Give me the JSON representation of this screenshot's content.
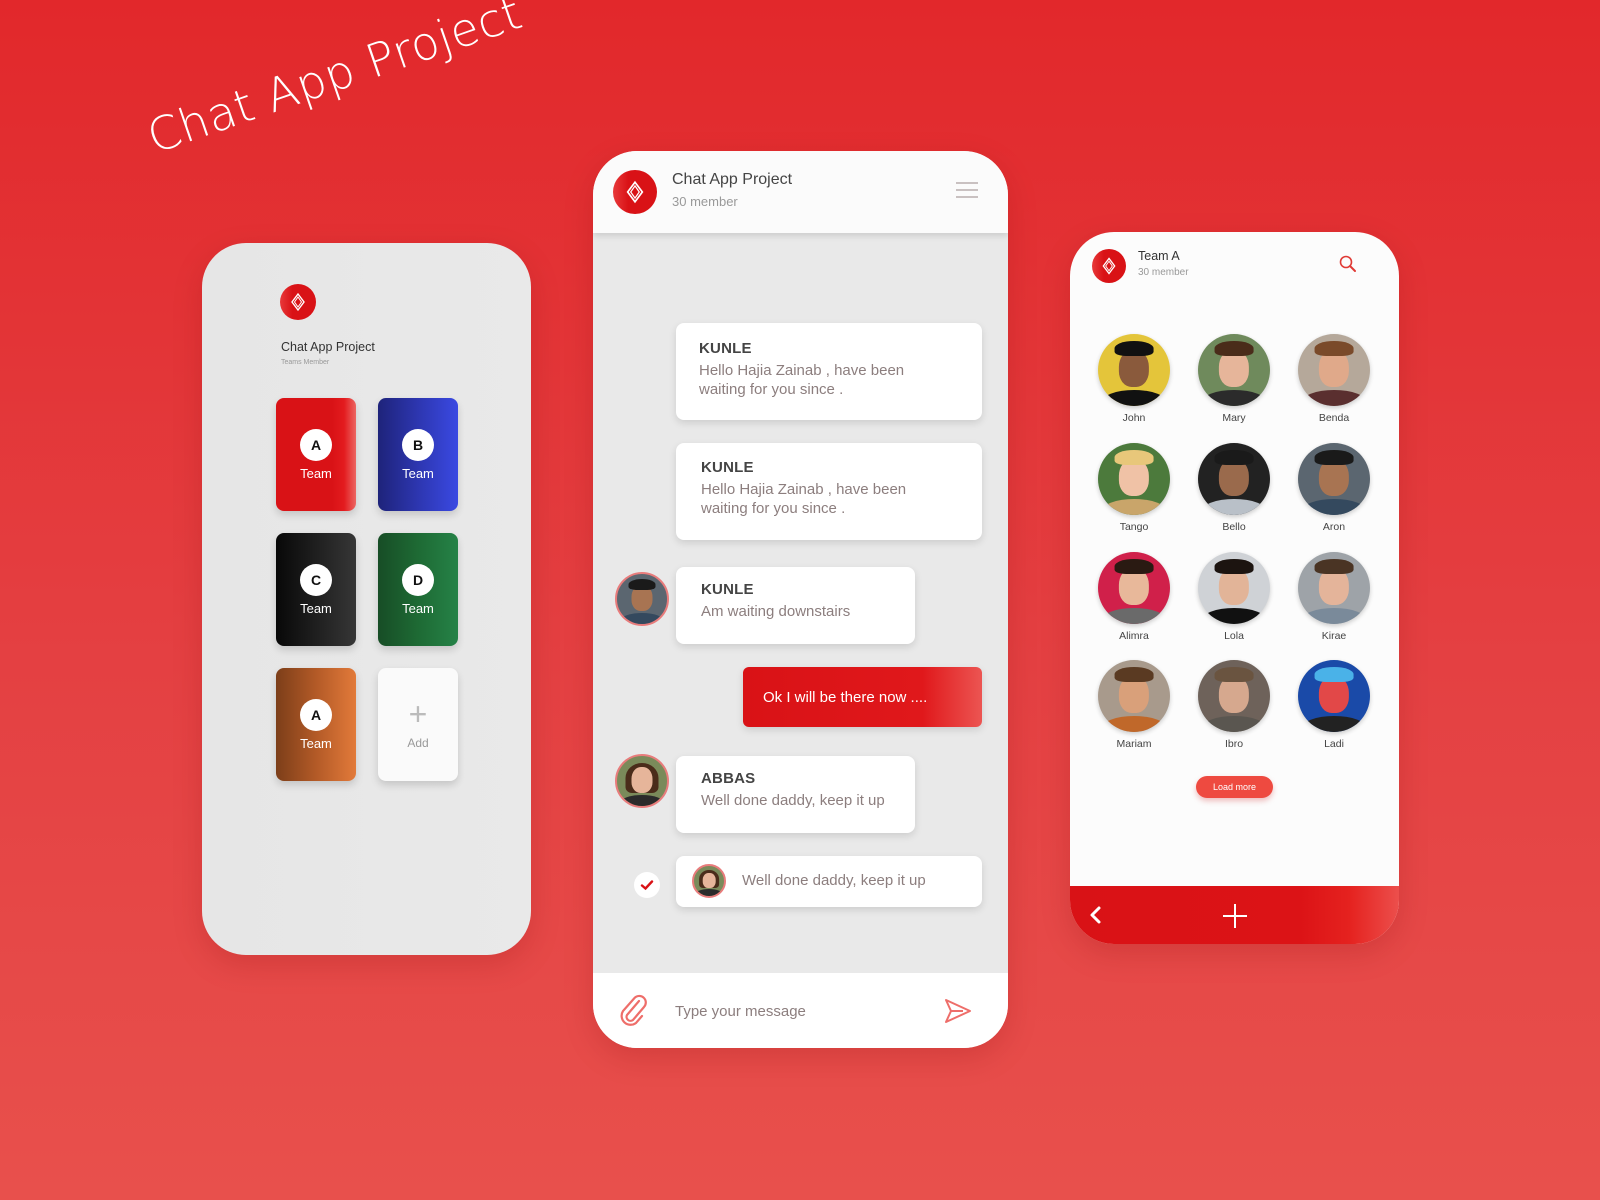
{
  "hero": {
    "title": "Chat App Project"
  },
  "teams_screen": {
    "title": "Chat App Project",
    "subtitle": "Teams Member",
    "teams": [
      {
        "letter": "A",
        "label": "Team",
        "gradient": [
          "#d91216",
          "#e31b1e",
          "#ec6662"
        ]
      },
      {
        "letter": "B",
        "label": "Team",
        "gradient": [
          "#1e237a",
          "#2d36b0",
          "#3a49e2"
        ]
      },
      {
        "letter": "C",
        "label": "Team",
        "gradient": [
          "#080808",
          "#1f1f1f",
          "#363636"
        ]
      },
      {
        "letter": "D",
        "label": "Team",
        "gradient": [
          "#174d26",
          "#1e6a34",
          "#258247"
        ]
      },
      {
        "letter": "A",
        "label": "Team",
        "gradient": [
          "#7c3e19",
          "#b35a27",
          "#e27a3a"
        ]
      }
    ],
    "add_label": "Add",
    "add_icon": "plus-icon"
  },
  "chat_screen": {
    "header": {
      "title": "Chat App Project",
      "subtitle": "30 member",
      "menu_icon": "hamburger-icon"
    },
    "messages": [
      {
        "name": "KUNLE",
        "text": "Hello Hajia Zainab , have been waiting for you since ."
      },
      {
        "name": "KUNLE",
        "text": "Hello Hajia Zainab , have been waiting for you since ."
      },
      {
        "name": "KUNLE",
        "text": "Am waiting downstairs"
      },
      {
        "name": "",
        "text": "Ok I will be there now ...."
      },
      {
        "name": "ABBAS",
        "text": "Well done daddy, keep it up"
      },
      {
        "name": "",
        "text": "Well done daddy, keep it up"
      }
    ],
    "composer": {
      "placeholder": "Type your message",
      "value": "",
      "attach_icon": "paperclip-icon",
      "send_icon": "send-icon"
    }
  },
  "members_screen": {
    "header": {
      "title": "Team A",
      "subtitle": "30 member",
      "search_icon": "search-icon"
    },
    "members": [
      {
        "name": "John",
        "bg": "#e4c53a",
        "skin": "#8a5a3c",
        "hair": "#111",
        "shirt": "#111"
      },
      {
        "name": "Mary",
        "bg": "#6f8a5c",
        "skin": "#e6b59a",
        "hair": "#4a2c1a",
        "shirt": "#2b2b2b"
      },
      {
        "name": "Benda",
        "bg": "#b5a89a",
        "skin": "#e0a98a",
        "hair": "#7a4a2a",
        "shirt": "#5a2f2f"
      },
      {
        "name": "Tango",
        "bg": "#4c7a3c",
        "skin": "#f0c2a6",
        "hair": "#e8c77a",
        "shirt": "#c9a56a"
      },
      {
        "name": "Bello",
        "bg": "#222222",
        "skin": "#9a6a4c",
        "hair": "#1a1a1a",
        "shirt": "#b9c0c8"
      },
      {
        "name": "Aron",
        "bg": "#5b6670",
        "skin": "#a87452",
        "hair": "#1a1a1a",
        "shirt": "#34495e"
      },
      {
        "name": "Alimra",
        "bg": "#d0204a",
        "skin": "#e8b89a",
        "hair": "#2a1a12",
        "shirt": "#6a6a6a"
      },
      {
        "name": "Lola",
        "bg": "#cfd2d6",
        "skin": "#e2b498",
        "hair": "#1c1410",
        "shirt": "#111"
      },
      {
        "name": "Kirae",
        "bg": "#9ea3a8",
        "skin": "#e4b49a",
        "hair": "#4a3424",
        "shirt": "#7a8a9a"
      },
      {
        "name": "Mariam",
        "bg": "#a89a8c",
        "skin": "#d9a07a",
        "hair": "#5a3a22",
        "shirt": "#c0682a"
      },
      {
        "name": "Ibro",
        "bg": "#6e625a",
        "skin": "#d6a88e",
        "hair": "#6a5440",
        "shirt": "#5a5650"
      },
      {
        "name": "Ladi",
        "bg": "#1a4aa8",
        "skin": "#e24848",
        "hair": "#4ab2e8",
        "shirt": "#222"
      }
    ],
    "load_more_label": "Load more",
    "back_icon": "chevron-left-icon",
    "add_icon": "plus-icon"
  },
  "colors": {
    "brand_red": "#d91216",
    "accent_light_red": "#ee4a40",
    "bubble_text": "#8c7e7e"
  }
}
